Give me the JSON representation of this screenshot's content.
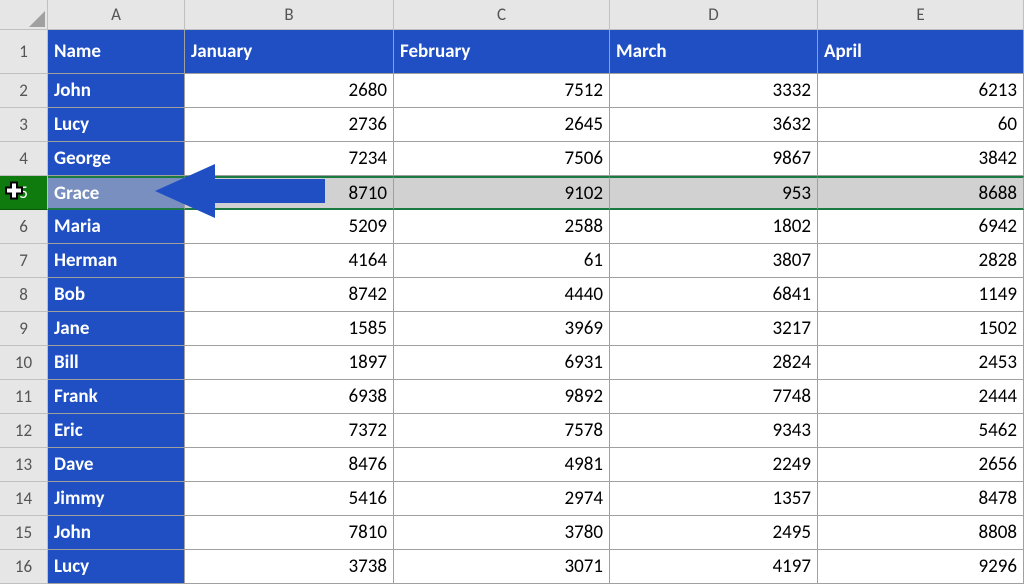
{
  "columns": [
    "A",
    "B",
    "C",
    "D",
    "E"
  ],
  "row_numbers": [
    "1",
    "2",
    "3",
    "4",
    "5",
    "6",
    "7",
    "8",
    "9",
    "10",
    "11",
    "12",
    "13",
    "14",
    "15",
    "16"
  ],
  "selected_row_index": 4,
  "chart_data": {
    "type": "table",
    "headers": {
      "name": "Name",
      "january": "January",
      "february": "February",
      "march": "March",
      "april": "April"
    },
    "rows": [
      {
        "name": "John",
        "january": 2680,
        "february": 7512,
        "march": 3332,
        "april": 6213
      },
      {
        "name": "Lucy",
        "january": 2736,
        "february": 2645,
        "march": 3632,
        "april": 60
      },
      {
        "name": "George",
        "january": 7234,
        "february": 7506,
        "march": 9867,
        "april": 3842
      },
      {
        "name": "Grace",
        "january": 8710,
        "february": 9102,
        "march": 953,
        "april": 8688
      },
      {
        "name": "Maria",
        "january": 5209,
        "february": 2588,
        "march": 1802,
        "april": 6942
      },
      {
        "name": "Herman",
        "january": 4164,
        "february": 61,
        "march": 3807,
        "april": 2828
      },
      {
        "name": "Bob",
        "january": 8742,
        "february": 4440,
        "march": 6841,
        "april": 1149
      },
      {
        "name": "Jane",
        "january": 1585,
        "february": 3969,
        "march": 3217,
        "april": 1502
      },
      {
        "name": "Bill",
        "january": 1897,
        "february": 6931,
        "march": 2824,
        "april": 2453
      },
      {
        "name": "Frank",
        "january": 6938,
        "february": 9892,
        "march": 7748,
        "april": 2444
      },
      {
        "name": "Eric",
        "january": 7372,
        "february": 7578,
        "march": 9343,
        "april": 5462
      },
      {
        "name": "Dave",
        "january": 8476,
        "february": 4981,
        "march": 2249,
        "april": 2656
      },
      {
        "name": "Jimmy",
        "january": 5416,
        "february": 2974,
        "march": 1357,
        "april": 8478
      },
      {
        "name": "John",
        "january": 7810,
        "february": 3780,
        "march": 2495,
        "april": 8808
      },
      {
        "name": "Lucy",
        "january": 3738,
        "february": 3071,
        "march": 4197,
        "april": 9296
      }
    ]
  }
}
